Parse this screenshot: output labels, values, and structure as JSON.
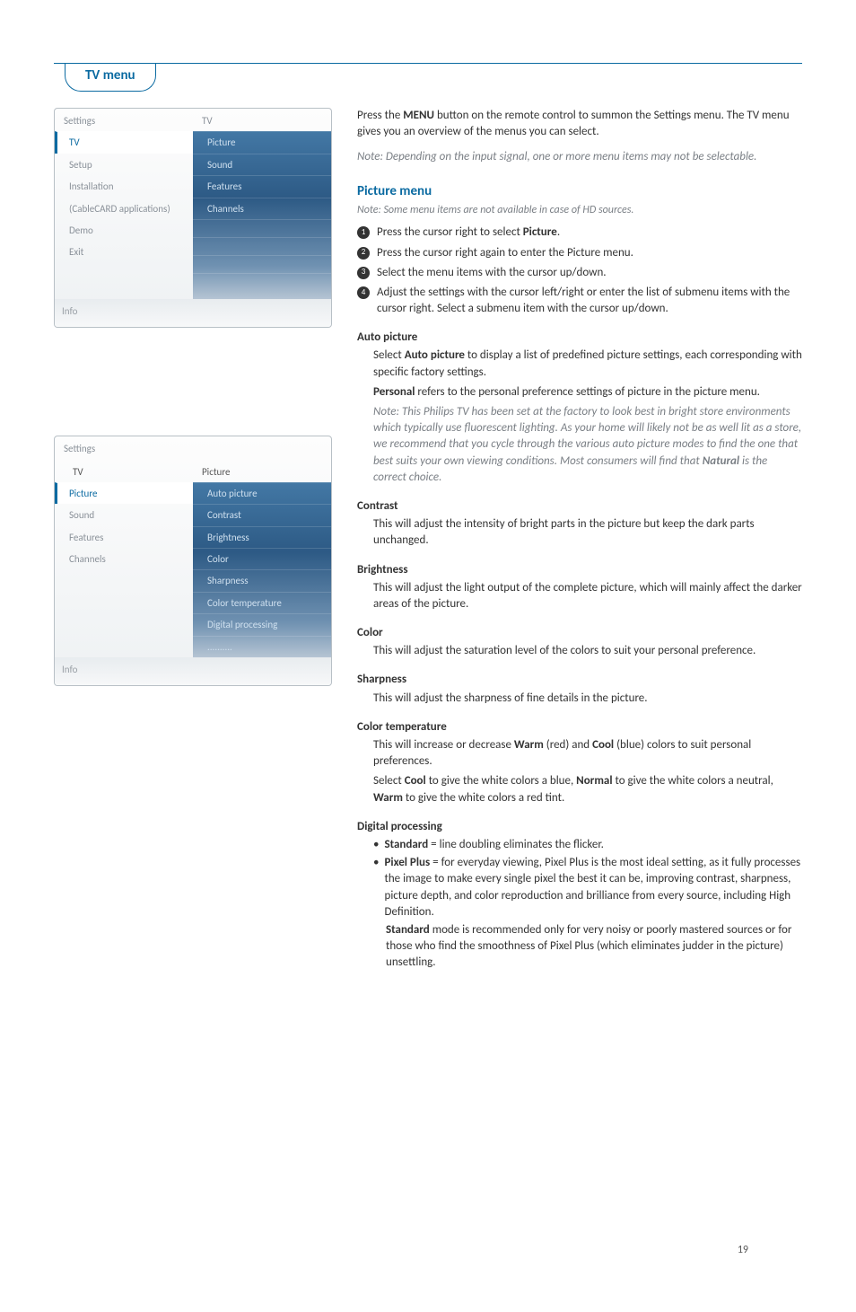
{
  "tab_title": "TV menu",
  "page_number": "19",
  "panel1": {
    "header_left": "Settings",
    "header_right": "TV",
    "left_items": [
      "TV",
      "Setup",
      "Installation",
      "(CableCARD applications)",
      "Demo",
      "Exit",
      "",
      ""
    ],
    "right_items": [
      "Picture",
      "Sound",
      "Features",
      "Channels",
      "",
      "",
      "",
      ""
    ],
    "selected_left_index": 0,
    "footer": "Info"
  },
  "panel2": {
    "header_left": "Settings",
    "header_right": "",
    "sub_left": "TV",
    "sub_right": "Picture",
    "left_items": [
      "Picture",
      "Sound",
      "Features",
      "Channels",
      "",
      "",
      "",
      ""
    ],
    "right_items": [
      "Auto picture",
      "Contrast",
      "Brightness",
      "Color",
      "Sharpness",
      "Color temperature",
      "Digital processing",
      ".........."
    ],
    "selected_left_index": 0,
    "footer": "Info"
  },
  "intro": {
    "line1a": "Press the ",
    "line1b": "MENU",
    "line1c": " button on the remote control to summon the Settings menu. The TV menu gives you an overview of the menus you can select.",
    "note": "Note: Depending on the input signal, one or more menu items may not be selectable."
  },
  "picture_menu": {
    "heading": "Picture menu",
    "note": "Note: Some menu items are not available in case of HD sources.",
    "steps": [
      {
        "pre": "Press the cursor right to select ",
        "bold": "Picture",
        "post": "."
      },
      {
        "pre": "Press the cursor right again to enter the Picture menu.",
        "bold": "",
        "post": ""
      },
      {
        "pre": "Select the menu items with the cursor up/down.",
        "bold": "",
        "post": ""
      },
      {
        "pre": "Adjust the settings with the cursor left/right or enter the list of submenu items with the cursor right. Select a submenu item with the cursor up/down.",
        "bold": "",
        "post": ""
      }
    ]
  },
  "sections": {
    "auto_picture": {
      "title": "Auto picture",
      "p1a": "Select ",
      "p1b": "Auto picture",
      "p1c": " to display a list of predefined picture settings, each corresponding with specific factory settings.",
      "p2a": "Personal",
      "p2b": " refers to the personal preference settings of picture in the picture menu.",
      "note_a": "Note: This Philips TV has been set at the factory to look best in bright store environments which typically use fluorescent lighting. As your home will likely not be as well lit as a store, we recommend that you cycle through the various auto picture modes to find the one that best suits your own viewing conditions. Most consumers will find that ",
      "note_b": "Natural",
      "note_c": " is the correct choice."
    },
    "contrast": {
      "title": "Contrast",
      "desc": "This will adjust the intensity of bright parts in the picture but keep the dark parts unchanged."
    },
    "brightness": {
      "title": "Brightness",
      "desc": "This will adjust the light output of the complete picture, which will mainly affect the darker areas of the picture."
    },
    "color": {
      "title": "Color",
      "desc": "This will adjust the saturation level of the colors to suit your personal preference."
    },
    "sharpness": {
      "title": "Sharpness",
      "desc": "This will adjust the sharpness of fine details in the picture."
    },
    "color_temp": {
      "title": "Color temperature",
      "p1a": "This will increase or decrease ",
      "p1b": "Warm",
      "p1c": " (red) and ",
      "p1d": "Cool",
      "p1e": " (blue) colors to suit personal preferences.",
      "p2a": "Select ",
      "p2b": "Cool",
      "p2c": " to give the white colors a blue, ",
      "p2d": "Normal",
      "p2e": " to give the white colors a neutral, ",
      "p2f": "Warm",
      "p2g": " to give the white colors a red tint."
    },
    "digital": {
      "title": "Digital processing",
      "b1a": "Standard",
      "b1b": " = line doubling eliminates the flicker.",
      "b2a": "Pixel Plus",
      "b2b": " = for everyday viewing, Pixel Plus is the most ideal setting, as it fully processes the image to make every single pixel the best it can be, improving contrast, sharpness, picture depth, and color reproduction and brilliance from every source, including High Definition.",
      "b3a": "Standard",
      "b3b": " mode is recommended only for very noisy or poorly mastered sources or for those who find the smoothness of Pixel Plus (which eliminates judder in the picture) unsettling."
    }
  }
}
